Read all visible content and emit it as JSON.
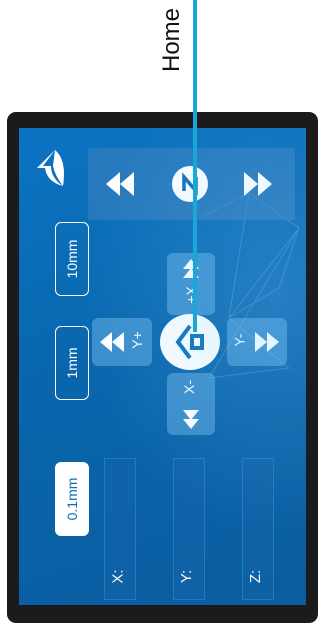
{
  "callout": {
    "label": "Home"
  },
  "step_sizes": [
    {
      "label": "0.1mm",
      "selected": true
    },
    {
      "label": "1mm",
      "selected": false
    },
    {
      "label": "10mm",
      "selected": false
    }
  ],
  "jog": {
    "y_plus": "Y+",
    "y_minus": "Y-",
    "x_plus": "+X",
    "x_minus": "X-"
  },
  "coords": {
    "x_label": "X:",
    "y_label": "Y:",
    "z_label": "Z:"
  },
  "colors": {
    "screen": "#0a6fb8",
    "frame": "#1b1b1d",
    "callout_line": "#1aa6d6"
  },
  "icons": [
    "back-arrow-icon",
    "rewind-icon",
    "n-circle-icon",
    "fast-forward-icon",
    "home-icon"
  ]
}
